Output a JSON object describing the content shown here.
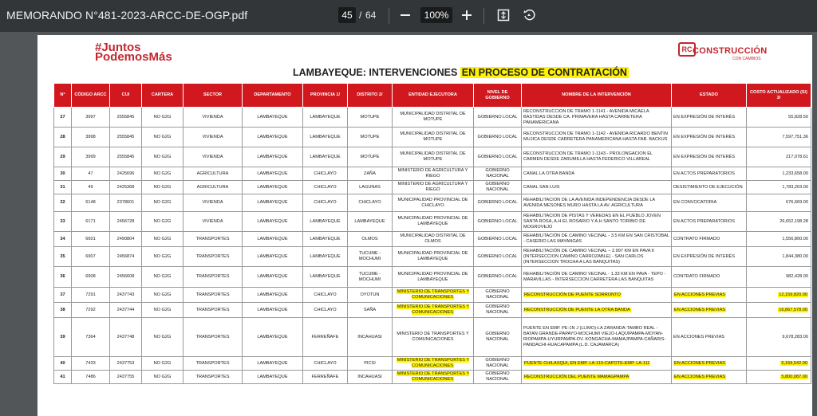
{
  "toolbar": {
    "title": "MEMORANDO N°481-2023-ARCC-DE-OGP.pdf",
    "current_page": "45",
    "page_separator": "/",
    "total_pages": "64",
    "zoom": "100%",
    "icons": {
      "zoom_out": "minus-icon",
      "zoom_in": "plus-icon",
      "fit": "fit-to-page-icon",
      "rotate": "rotate-icon"
    }
  },
  "document": {
    "logo_left_line1": "#Juntos",
    "logo_left_line2": "PodemosMás",
    "logo_right_mark": "RC",
    "logo_right_text": "CONSTRUCCIÓN",
    "logo_right_sub": "CON CAMBIOS",
    "heading_part1": "LAMBAYEQUE: INTERVENCIONES ",
    "heading_part2": "EN PROCESO DE CONTRATACIÓN",
    "highlight_color": "#fff200",
    "header_color": "#d1181e",
    "columns": [
      "N°",
      "CÓDIGO ARCC",
      "CUI",
      "CARTERA",
      "SECTOR",
      "DEPARTAMENTO",
      "PROVINCIA 1/",
      "DISTRITO 2/",
      "ENTIDAD EJECUTORA",
      "NIVEL DE GOBIERNO",
      "NOMBRE DE LA INTERVENCIÓN",
      "ESTADO",
      "COSTO ACTUALIZADO (S/) 3/"
    ],
    "rows": [
      {
        "n": "27",
        "code": "3997",
        "cui": "2555845",
        "cartera": "NO G2G",
        "sector": "VIVIENDA",
        "dep": "LAMBAYEQUE",
        "prov": "LAMBAYEQUE",
        "dist": "MOTUPE",
        "ent": "MUNICIPALIDAD DISTRITAL DE MOTUPE",
        "nivel": "GOBIERNO LOCAL",
        "nombre": "RECONSTRUCCION DE TRAMO 1-1141 - AVENIDA MICAELA BASTIDAS DESDE CA. PRIMAVERA HASTA CARRETERA PANAMERICANA",
        "estado": "EN EXPRESIÓN DE INTERÉS",
        "costo": "55,828.50",
        "hl": false
      },
      {
        "n": "28",
        "code": "3998",
        "cui": "2555845",
        "cartera": "NO G2G",
        "sector": "VIVIENDA",
        "dep": "LAMBAYEQUE",
        "prov": "LAMBAYEQUE",
        "dist": "MOTUPE",
        "ent": "MUNICIPALIDAD DISTRITAL DE MOTUPE",
        "nivel": "GOBIERNO LOCAL",
        "nombre": "RECONSTRUCCION DE TRAMO 1-1142 - AVENIDA RICARDO BENTIN MUJICA DESDE CARRETERA PANAMERICANA HASTA FAB. BACKUS",
        "estado": "EN EXPRESIÓN DE INTERÉS",
        "costo": "7,597,751.36",
        "hl": false
      },
      {
        "n": "29",
        "code": "3999",
        "cui": "2555845",
        "cartera": "NO G2G",
        "sector": "VIVIENDA",
        "dep": "LAMBAYEQUE",
        "prov": "LAMBAYEQUE",
        "dist": "MOTUPE",
        "ent": "MUNICIPALIDAD DISTRITAL DE MOTUPE",
        "nivel": "GOBIERNO LOCAL",
        "nombre": "RECONSTRUCCION DE TRAMO 1-1143 - PROLONGACION EL CARMEN DESDE ZARUMILLA HASTA FEDERICO VILLAREAL",
        "estado": "EN EXPRESIÓN DE INTERÉS",
        "costo": "217,078.61",
        "hl": false
      },
      {
        "n": "30",
        "code": "47",
        "cui": "2425696",
        "cartera": "NO G2G",
        "sector": "AGRICULTURA",
        "dep": "LAMBAYEQUE",
        "prov": "CHICLAYO",
        "dist": "ZAÑA",
        "ent": "MINISTERIO DE AGRICULTURA Y RIEGO",
        "nivel": "GOBIERNO NACIONAL",
        "nombre": "CANAL LA OTRA BANDA",
        "estado": "EN ACTOS PREPARATORIOS",
        "costo": "1,233,658.00",
        "hl": false
      },
      {
        "n": "31",
        "code": "49",
        "cui": "2425368",
        "cartera": "NO G2G",
        "sector": "AGRICULTURA",
        "dep": "LAMBAYEQUE",
        "prov": "CHICLAYO",
        "dist": "LAGUNAS",
        "ent": "MINISTERIO DE AGRICULTURA Y RIEGO",
        "nivel": "GOBIERNO NACIONAL",
        "nombre": "CANAL SAN LUIS",
        "estado": "DESISTIMIENTO DE EJECUCIÓN",
        "costo": "1,783,263.00",
        "hl": false
      },
      {
        "n": "32",
        "code": "6148",
        "cui": "2378601",
        "cartera": "NO G2G",
        "sector": "VIVIENDA",
        "dep": "LAMBAYEQUE",
        "prov": "CHICLAYO",
        "dist": "CHICLAYO",
        "ent": "MUNICIPALIDAD PROVINCIAL DE CHICLAYO",
        "nivel": "GOBIERNO LOCAL",
        "nombre": "REHABILITACION DE LA AVENIDA INDEPENDENCIA DESDE LA AVENIDA MESONES MURO HASTA LA AV. AGRICULTURA",
        "estado": "EN CONVOCATORIA",
        "costo": "676,669.00",
        "hl": false
      },
      {
        "n": "33",
        "code": "6171",
        "cui": "2456728",
        "cartera": "NO G2G",
        "sector": "VIVIENDA",
        "dep": "LAMBAYEQUE",
        "prov": "LAMBAYEQUE",
        "dist": "LAMBAYEQUE",
        "ent": "MUNICIPALIDAD PROVINCIAL DE LAMBAYEQUE",
        "nivel": "GOBIERNO LOCAL",
        "nombre": "REHABILITACION DE PISTAS Y VEREDAS EN EL PUEBLO JOVEN SANTA ROSA, A.H EL ROSARIO Y A.H SANTO TORIBIO DE MOGROVEJO",
        "estado": "EN ACTOS PREPARATORIOS",
        "costo": "26,652,198.28",
        "hl": false
      },
      {
        "n": "34",
        "code": "6601",
        "cui": "2490804",
        "cartera": "NO G2G",
        "sector": "TRANSPORTES",
        "dep": "LAMBAYEQUE",
        "prov": "LAMBAYEQUE",
        "dist": "OLMOS",
        "ent": "MUNICIPALIDAD DISTRITAL DE OLMOS",
        "nivel": "GOBIERNO LOCAL",
        "nombre": "REHABILITACIÓN DE CAMINO VECINAL - 3.5 KM EN SAN CRISTOBAL - CASERIO LAS MAYANGAS",
        "estado": "CONTRATO FIRMADO",
        "costo": "1,556,800.00",
        "hl": false
      },
      {
        "n": "35",
        "code": "6907",
        "cui": "2456874",
        "cartera": "NO G2G",
        "sector": "TRANSPORTES",
        "dep": "LAMBAYEQUE",
        "prov": "LAMBAYEQUE",
        "dist": "TUCUME - MOCHUMI",
        "ent": "MUNICIPALIDAD PROVINCIAL DE LAMBAYEQUE",
        "nivel": "GOBIERNO LOCAL",
        "nombre": "REHABILITACIÓN DE CAMINO VECINAL – 2.997 KM EN PAVA II (INTERSECCION CAMINO CARROZABLE) - SAN CARLOS (INTERSECCION TROCHA A LAS BANQUITAS)",
        "estado": "EN EXPRESIÓN DE INTERÉS",
        "costo": "1,844,380.00",
        "hl": false
      },
      {
        "n": "36",
        "code": "6908",
        "cui": "2456608",
        "cartera": "NO G2G",
        "sector": "TRANSPORTES",
        "dep": "LAMBAYEQUE",
        "prov": "LAMBAYEQUE",
        "dist": "TUCUME - MOCHUMI",
        "ent": "MUNICIPALIDAD PROVINCIAL DE LAMBAYEQUE",
        "nivel": "GOBIERNO LOCAL",
        "nombre": "REHABILITACIÓN DE CAMINO VECINAL - 1.33 KM EN PAVA - TEPO - MARAVILLAS - INTERSECCION CARRETERA LAS BANQUITAS",
        "estado": "CONTRATO FIRMADO",
        "costo": "982,428.00",
        "hl": false
      },
      {
        "n": "37",
        "code": "7291",
        "cui": "2437743",
        "cartera": "NO G2G",
        "sector": "TRANSPORTES",
        "dep": "LAMBAYEQUE",
        "prov": "CHICLAYO",
        "dist": "OYOTUN",
        "ent": "MINISTERIO DE TRANSPORTES Y COMUNICACIONES",
        "nivel": "GOBIERNO NACIONAL",
        "nombre": "RECONSTRUCCIÓN DE PUENTE SORRONTO",
        "estado": "EN ACCIONES PREVIAS",
        "costo": "12,159,820.00",
        "hl": true
      },
      {
        "n": "38",
        "code": "7292",
        "cui": "2437744",
        "cartera": "NO G2G",
        "sector": "TRANSPORTES",
        "dep": "LAMBAYEQUE",
        "prov": "CHICLAYO",
        "dist": "SAÑA",
        "ent": "MINISTERIO DE TRANSPORTES Y COMUNICACIONES",
        "nivel": "GOBIERNO NACIONAL",
        "nombre": "RECONSTRUCCIÓN DE PUENTE LA OTRA BANDA",
        "estado": "EN ACCIONES PREVIAS",
        "costo": "16,867,578.00",
        "hl": true
      },
      {
        "n": "39",
        "code": "7364",
        "cui": "2437748",
        "cartera": "NO G2G",
        "sector": "TRANSPORTES",
        "dep": "LAMBAYEQUE",
        "prov": "FERREÑAFE",
        "dist": "INCAHUASI",
        "ent": "MINISTERIO DE TRANSPORTES Y COMUNICACIONES",
        "nivel": "GOBIERNO NACIONAL",
        "nombre": "PUENTE EN EMP. PE-1N J (LLIMO)-LA ZARANDA-TAMBO REAL - BATAN GRANDE-PAPAYO-MOCHUMI VIEJO-LAQUIPAMPA-MOYAN-RIOPAMPA-UYURPAMPA-DV. KONGACHA-MAMAJPAMPA-CAÑARIS-PANDACHI-HUACAPAMPA (L.D. CAJAMARCA)",
        "estado": "EN ACCIONES PREVIAS",
        "costo": "9,678,283.00",
        "hl": false
      },
      {
        "n": "40",
        "code": "7433",
        "cui": "2437753",
        "cartera": "NO G2G",
        "sector": "TRANSPORTES",
        "dep": "LAMBAYEQUE",
        "prov": "CHICLAYO",
        "dist": "PICSI",
        "ent": "MINISTERIO DE TRANSPORTES Y COMUNICACIONES",
        "nivel": "GOBIERNO NACIONAL",
        "nombre": "PUENTE CHILASQUI, EN EMP. LA-110-CAPOTE-EMP. LA-111",
        "estado": "EN ACCIONES PREVIAS",
        "costo": "5,169,542.00",
        "hl": true
      },
      {
        "n": "41",
        "code": "7486",
        "cui": "2437755",
        "cartera": "NO G2G",
        "sector": "TRANSPORTES",
        "dep": "LAMBAYEQUE",
        "prov": "FERREÑAFE",
        "dist": "INCAHUASI",
        "ent": "MINISTERIO DE TRANSPORTES Y COMUNICACIONES",
        "nivel": "GOBIERNO NACIONAL",
        "nombre": "RECONSTRUCCIÓN DEL PUENTE MAMAGPAMPA",
        "estado": "EN ACCIONES PREVIAS",
        "costo": "5,800,087.00",
        "hl": true
      }
    ]
  }
}
